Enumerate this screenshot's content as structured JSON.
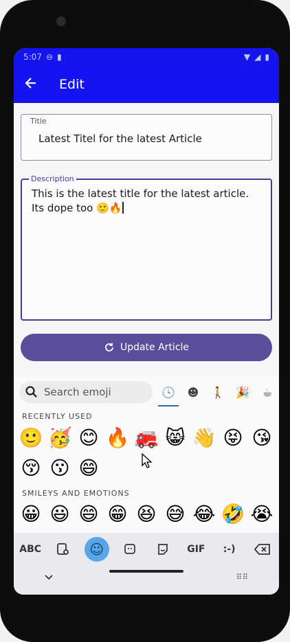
{
  "status": {
    "time": "5:07"
  },
  "appbar": {
    "title": "Edit"
  },
  "form": {
    "title_label": "Title",
    "title_value": "Latest Titel for the latest Article",
    "description_label": "Description",
    "description_value": "This is the latest title for the latest article. Its dope too 🙂🔥",
    "update_button": "Update Article"
  },
  "emoji_keyboard": {
    "search_placeholder": "Search emoji",
    "categories": [
      "recent-icon",
      "smiley-icon",
      "person-icon",
      "activity-icon",
      "food-icon"
    ],
    "recently_used_label": "RECENTLY USED",
    "recently_used": [
      "🙂",
      "🥳",
      "😊",
      "🔥",
      "🚒",
      "😸",
      "👋",
      "😝",
      "😘",
      "😚",
      "😗",
      "😄"
    ],
    "smileys_label": "SMILEYS AND EMOTIONS",
    "smileys": [
      "😀",
      "😃",
      "😄",
      "😁",
      "😆",
      "😅",
      "😂",
      "🤣",
      "😭"
    ]
  },
  "toolbar": {
    "abc": "ABC",
    "gif": "GIF",
    "emoticon": ":-)"
  }
}
